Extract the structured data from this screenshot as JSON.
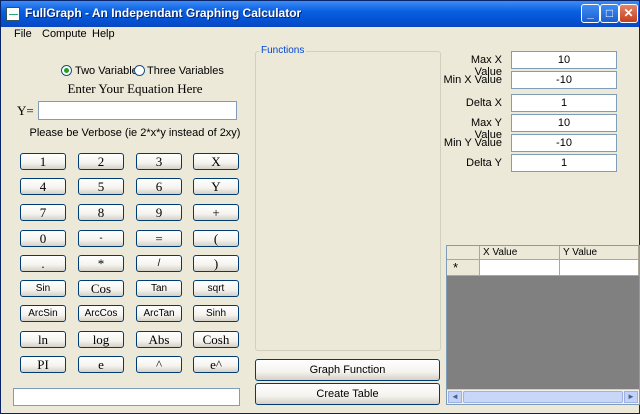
{
  "window": {
    "title": "FullGraph - An Independant Graphing Calculator"
  },
  "titlebar_buttons": {
    "minimize": "_",
    "maximize": "□",
    "close": "✕"
  },
  "menu": [
    "File",
    "Compute",
    "Help"
  ],
  "mode": {
    "option1": "Two Variables",
    "option2": "Three Variables",
    "selected": "Two Variables"
  },
  "equation": {
    "heading": "Enter Your Equation Here",
    "prefix": "Y=",
    "value": "",
    "hint": "Please be Verbose (ie 2*x*y instead of 2xy)"
  },
  "keypad": [
    [
      "1",
      "2",
      "3",
      "X"
    ],
    [
      "4",
      "5",
      "6",
      "Y"
    ],
    [
      "7",
      "8",
      "9",
      "+"
    ],
    [
      "0",
      "-",
      "=",
      "("
    ],
    [
      ".",
      "*",
      "/",
      ")"
    ],
    [
      "Sin",
      "Cos",
      "Tan",
      "sqrt"
    ],
    [
      "ArcSin",
      "ArcCos",
      "ArcTan",
      "Sinh"
    ],
    [
      "ln",
      "log",
      "Abs",
      "Cosh"
    ],
    [
      "PI",
      "e",
      "^",
      "e^"
    ]
  ],
  "status_field": "",
  "functions_group": {
    "label": "Functions"
  },
  "actions": {
    "graph": "Graph Function",
    "table": "Create Table"
  },
  "ranges": [
    {
      "label": "Max X Value",
      "value": "10"
    },
    {
      "label": "Min X Value",
      "value": "-10"
    },
    {
      "label": "Delta X",
      "value": "1"
    },
    {
      "label": "Max Y Value",
      "value": "10"
    },
    {
      "label": "Min Y Value",
      "value": "-10"
    },
    {
      "label": "Delta Y",
      "value": "1"
    }
  ],
  "table": {
    "columns": [
      "X Value",
      "Y Value"
    ],
    "new_row_marker": "*"
  },
  "scrollbar": {
    "left": "◄",
    "right": "►"
  }
}
